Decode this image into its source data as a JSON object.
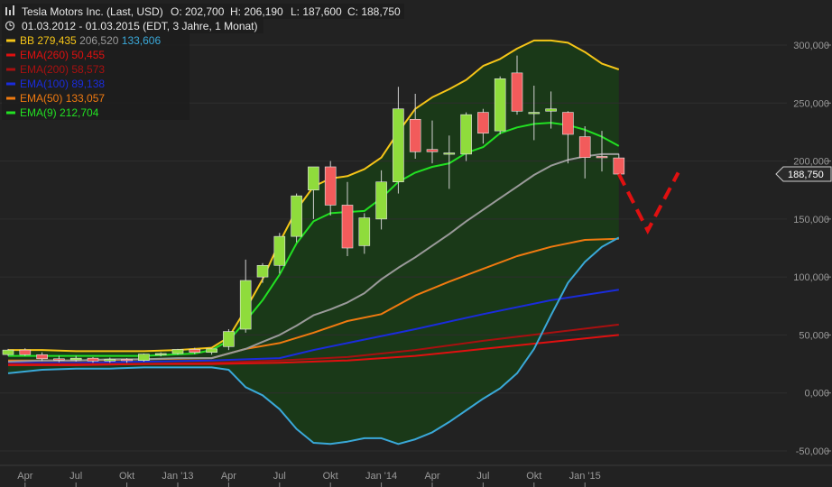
{
  "header": {
    "title": "Tesla Motors Inc. (Last, USD)",
    "open": "O: 202,700",
    "high": "H: 206,190",
    "low": "L: 187,600",
    "close": "C: 188,750",
    "period": "01.03.2012 - 01.03.2015 (EDT, 3 Jahre, 1 Monat)",
    "clock_icon": "clock-icon"
  },
  "legend": [
    {
      "label": "BB",
      "values": [
        "279,435",
        "206,520",
        "133,606"
      ],
      "colors": [
        "#f5c518",
        "#9a9a9a",
        "#3aa8d8"
      ]
    },
    {
      "label": "EMA(260)",
      "values": [
        "50,455"
      ],
      "colors": [
        "#e01010"
      ]
    },
    {
      "label": "EMA(200)",
      "values": [
        "58,573"
      ],
      "colors": [
        "#a81010"
      ]
    },
    {
      "label": "EMA(100)",
      "values": [
        "89,138"
      ],
      "colors": [
        "#1a2cdc"
      ]
    },
    {
      "label": "EMA(50)",
      "values": [
        "133,057"
      ],
      "colors": [
        "#f07a10"
      ]
    },
    {
      "label": "EMA(9)",
      "values": [
        "212,704"
      ],
      "colors": [
        "#22e022"
      ]
    }
  ],
  "chart_data": {
    "type": "candlestick",
    "last_price_label": "188,750",
    "last_price": 188.75,
    "ylim": [
      -60,
      310
    ],
    "y_ticks": [
      {
        "v": 300,
        "label": "300,000"
      },
      {
        "v": 250,
        "label": "250,000"
      },
      {
        "v": 200,
        "label": "200,000"
      },
      {
        "v": 150,
        "label": "150,000"
      },
      {
        "v": 100,
        "label": "100,000"
      },
      {
        "v": 50,
        "label": "50,000"
      },
      {
        "v": 0,
        "label": "0,000"
      },
      {
        "v": -50,
        "label": "-50,000"
      }
    ],
    "x_ticks": [
      {
        "i": 1,
        "label": "Apr"
      },
      {
        "i": 4,
        "label": "Jul"
      },
      {
        "i": 7,
        "label": "Okt"
      },
      {
        "i": 10,
        "label": "Jan '13"
      },
      {
        "i": 13,
        "label": "Apr"
      },
      {
        "i": 16,
        "label": "Jul"
      },
      {
        "i": 19,
        "label": "Okt"
      },
      {
        "i": 22,
        "label": "Jan '14"
      },
      {
        "i": 25,
        "label": "Apr"
      },
      {
        "i": 28,
        "label": "Jul"
      },
      {
        "i": 31,
        "label": "Okt"
      },
      {
        "i": 34,
        "label": "Jan '15"
      }
    ],
    "candles": [
      {
        "o": 33.1,
        "h": 38.0,
        "l": 32.0,
        "c": 37.0
      },
      {
        "o": 37.0,
        "h": 38.5,
        "l": 32.0,
        "c": 33.0
      },
      {
        "o": 33.0,
        "h": 35.0,
        "l": 27.5,
        "c": 29.5
      },
      {
        "o": 29.5,
        "h": 32.0,
        "l": 26.5,
        "c": 28.5
      },
      {
        "o": 28.5,
        "h": 32.0,
        "l": 27.0,
        "c": 30.0
      },
      {
        "o": 30.0,
        "h": 31.0,
        "l": 26.0,
        "c": 27.5
      },
      {
        "o": 27.5,
        "h": 30.5,
        "l": 26.0,
        "c": 29.0
      },
      {
        "o": 29.0,
        "h": 30.0,
        "l": 26.0,
        "c": 28.0
      },
      {
        "o": 28.0,
        "h": 34.0,
        "l": 27.0,
        "c": 33.5
      },
      {
        "o": 33.5,
        "h": 35.0,
        "l": 31.5,
        "c": 34.0
      },
      {
        "o": 34.0,
        "h": 38.0,
        "l": 33.0,
        "c": 37.5
      },
      {
        "o": 37.5,
        "h": 39.0,
        "l": 33.5,
        "c": 35.0
      },
      {
        "o": 35.0,
        "h": 38.0,
        "l": 33.0,
        "c": 38.0
      },
      {
        "o": 40.0,
        "h": 55.0,
        "l": 37.0,
        "c": 53.0
      },
      {
        "o": 55.0,
        "h": 115.0,
        "l": 52.0,
        "c": 97.0
      },
      {
        "o": 100.0,
        "h": 112.0,
        "l": 95.0,
        "c": 110.0
      },
      {
        "o": 110.0,
        "h": 138.0,
        "l": 103.0,
        "c": 135.0
      },
      {
        "o": 135.0,
        "h": 172.0,
        "l": 130.0,
        "c": 170.0
      },
      {
        "o": 175.0,
        "h": 195.0,
        "l": 150.0,
        "c": 195.0
      },
      {
        "o": 195.0,
        "h": 200.0,
        "l": 153.0,
        "c": 162.0
      },
      {
        "o": 162.0,
        "h": 182.0,
        "l": 118.0,
        "c": 125.0
      },
      {
        "o": 127.0,
        "h": 155.0,
        "l": 120.0,
        "c": 151.0
      },
      {
        "o": 150.0,
        "h": 192.0,
        "l": 141.0,
        "c": 182.0
      },
      {
        "o": 182.0,
        "h": 264.0,
        "l": 172.0,
        "c": 245.0
      },
      {
        "o": 236.0,
        "h": 258.0,
        "l": 202.0,
        "c": 208.0
      },
      {
        "o": 210.0,
        "h": 235.0,
        "l": 198.0,
        "c": 208.0
      },
      {
        "o": 207.0,
        "h": 222.0,
        "l": 176.0,
        "c": 207.0
      },
      {
        "o": 206.0,
        "h": 242.0,
        "l": 200.0,
        "c": 240.0
      },
      {
        "o": 242.0,
        "h": 245.0,
        "l": 215.0,
        "c": 224.0
      },
      {
        "o": 226.0,
        "h": 273.0,
        "l": 223.0,
        "c": 271.0
      },
      {
        "o": 276.0,
        "h": 291.0,
        "l": 240.0,
        "c": 243.0
      },
      {
        "o": 242.0,
        "h": 265.0,
        "l": 218.0,
        "c": 242.0
      },
      {
        "o": 243.0,
        "h": 260.0,
        "l": 228.0,
        "c": 245.0
      },
      {
        "o": 242.0,
        "h": 243.0,
        "l": 198.0,
        "c": 223.0
      },
      {
        "o": 221.0,
        "h": 230.0,
        "l": 185.0,
        "c": 203.0
      },
      {
        "o": 204.0,
        "h": 226.0,
        "l": 191.0,
        "c": 203.0
      },
      {
        "o": 202.7,
        "h": 206.19,
        "l": 187.6,
        "c": 188.75
      }
    ],
    "series": [
      {
        "name": "BB",
        "color": "#f5c518",
        "x": [
          0,
          2,
          4,
          6,
          8,
          10,
          12,
          13,
          14,
          15,
          16,
          17,
          18,
          19,
          20,
          21,
          22,
          23,
          24,
          25,
          26,
          27,
          28,
          29,
          30,
          31,
          32,
          33,
          34,
          35,
          36
        ],
        "y": [
          37,
          37,
          36,
          36,
          36,
          37,
          39,
          48,
          72,
          98,
          130,
          158,
          178,
          185,
          187,
          193,
          203,
          225,
          245,
          255,
          262,
          270,
          282,
          288,
          297,
          304,
          304,
          302,
          294,
          284,
          279
        ]
      },
      {
        "name": "BB",
        "color": "#3aa8d8",
        "x": [
          0,
          2,
          4,
          6,
          8,
          10,
          12,
          13,
          14,
          15,
          16,
          17,
          18,
          19,
          20,
          21,
          22,
          23,
          24,
          25,
          26,
          27,
          28,
          29,
          30,
          31,
          32,
          33,
          34,
          35,
          36
        ],
        "y": [
          17,
          20,
          21,
          21,
          22,
          22,
          22,
          20,
          5,
          -2,
          -14,
          -31,
          -43,
          -44,
          -42,
          -39,
          -39,
          -44,
          -40,
          -34,
          -25,
          -15,
          -5,
          4,
          17,
          38,
          67,
          95,
          113,
          126,
          134
        ]
      },
      {
        "name": "BB",
        "color": "#9a9a9a",
        "x": [
          0,
          2,
          4,
          6,
          8,
          10,
          12,
          13,
          14,
          15,
          16,
          17,
          18,
          19,
          20,
          21,
          22,
          23,
          24,
          25,
          26,
          27,
          28,
          29,
          30,
          31,
          32,
          33,
          34,
          35,
          36
        ],
        "y": [
          27,
          28,
          28,
          29,
          29,
          30,
          30,
          34,
          38,
          44,
          50,
          58,
          67,
          72,
          78,
          86,
          98,
          108,
          117,
          127,
          137,
          148,
          158,
          168,
          178,
          188,
          196,
          201,
          204,
          206,
          206
        ]
      },
      {
        "name": "EMA(260)",
        "color": "#e01010",
        "x": [
          0,
          4,
          8,
          12,
          16,
          20,
          24,
          28,
          32,
          36
        ],
        "y": [
          24,
          24,
          25,
          25,
          26,
          28,
          32,
          38,
          44,
          50
        ]
      },
      {
        "name": "EMA(200)",
        "color": "#a81010",
        "x": [
          0,
          4,
          8,
          12,
          16,
          20,
          24,
          28,
          32,
          36
        ],
        "y": [
          25,
          25,
          25,
          26,
          28,
          31,
          37,
          45,
          52,
          59
        ]
      },
      {
        "name": "EMA(100)",
        "color": "#1a2cdc",
        "x": [
          0,
          4,
          8,
          12,
          16,
          18,
          20,
          24,
          28,
          32,
          36
        ],
        "y": [
          26,
          26,
          27,
          28,
          30,
          37,
          43,
          55,
          68,
          80,
          89
        ]
      },
      {
        "name": "EMA(50)",
        "color": "#f07a10",
        "x": [
          0,
          4,
          8,
          12,
          14,
          16,
          18,
          20,
          22,
          24,
          26,
          28,
          30,
          32,
          34,
          36
        ],
        "y": [
          28,
          28,
          29,
          30,
          38,
          43,
          52,
          62,
          68,
          84,
          96,
          107,
          118,
          126,
          132,
          133
        ]
      },
      {
        "name": "EMA(9)",
        "color": "#22e022",
        "x": [
          0,
          4,
          8,
          11,
          12,
          13,
          14,
          15,
          16,
          17,
          18,
          19,
          20,
          21,
          22,
          23,
          24,
          25,
          26,
          27,
          28,
          29,
          30,
          31,
          32,
          33,
          34,
          35,
          36
        ],
        "y": [
          32,
          32,
          32,
          34,
          37,
          45,
          62,
          80,
          102,
          129,
          148,
          155,
          156,
          157,
          168,
          182,
          190,
          195,
          198,
          207,
          212,
          224,
          229,
          232,
          233,
          231,
          227,
          221,
          213
        ]
      }
    ],
    "projection": {
      "color": "#e01010",
      "x": [
        36,
        37.7,
        39.5
      ],
      "y": [
        188.75,
        140,
        190
      ]
    }
  }
}
